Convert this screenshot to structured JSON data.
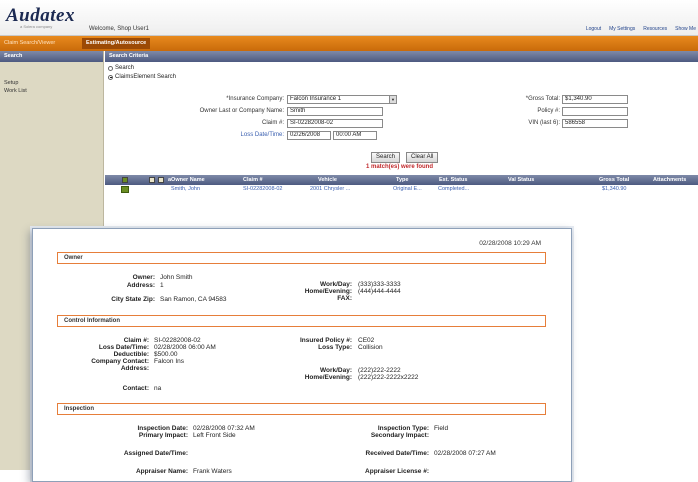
{
  "app": {
    "logo_text": "Audatex",
    "logo_tagline": "a Solera company",
    "welcome": "Welcome, Shop User1",
    "top_links": [
      "Logout",
      "My Settings",
      "Resources",
      "Show Me"
    ],
    "tabs": [
      "Claim Search/Viewer",
      "Estimating/Autosource"
    ],
    "active_tab_index": 1,
    "colors": {
      "brand_orange": "#d9761a",
      "header_blue": "#5b6790",
      "link_blue": "#3a5fb0",
      "alert_red": "#c0282b"
    }
  },
  "sidebar": {
    "header": "Search",
    "items": [
      "Setup",
      "Work List"
    ]
  },
  "criteria": {
    "header": "Search Criteria",
    "radio_search": "Search",
    "radio_claims_element": "ClaimsElement Search",
    "selected_radio": "ClaimsElement Search",
    "insurance_label": "*Insurance Company:",
    "insurance_value": "Falcon Insurance 1",
    "owner_label": "Owner Last or Company Name:",
    "owner_value": "Smith",
    "claim_label": "Claim #:",
    "claim_value": "SI-02282008-02",
    "loss_label": "Loss Date/Time:",
    "loss_date": "02/26/2008",
    "loss_time": "00:00 AM",
    "gross_label": "*Gross Total:",
    "gross_value": "$1,340.90",
    "policy_label": "Policy #:",
    "policy_value": "",
    "vin_label": "VIN (last 6):",
    "vin_value": "586558",
    "search_button": "Search",
    "clear_button": "Clear All",
    "matches_text": "1 match(es) were found"
  },
  "results": {
    "columns": [
      "aOwner Name",
      "Claim #",
      "Vehicle",
      "Type",
      "Est. Status",
      "Val Status",
      "Gross Total",
      "Attachments"
    ],
    "rows": [
      {
        "owner": "Smith, John",
        "claim": "SI-02282008-02",
        "vehicle": "2001 Chrysler ...",
        "type": "Original E...",
        "est_status": "Completed...",
        "val_status": "",
        "gross_total": "$1,340.90",
        "attachments": ""
      }
    ]
  },
  "report": {
    "datetime": "02/28/2008 10:29 AM",
    "owner_section": {
      "title": "Owner",
      "owner_label": "Owner:",
      "owner_value": "John Smith",
      "address_label": "Address:",
      "address_value": "1",
      "csz_label": "City State Zip:",
      "csz_value": "San Ramon, CA 94583",
      "work_label": "Work/Day:",
      "work_value": "(333)333-3333",
      "home_label": "Home/Evening:",
      "home_value": "(444)444-4444",
      "fax_label": "FAX:",
      "fax_value": ""
    },
    "control_section": {
      "title": "Control Information",
      "claim_label": "Claim #:",
      "claim_value": "SI-02282008-02",
      "loss_label": "Loss Date/Time:",
      "loss_value": "02/28/2008 06:00 AM",
      "deductible_label": "Deductible:",
      "deductible_value": "$500.00",
      "company_label": "Company Contact:",
      "company_value": "Falcon Ins",
      "address_label": "Address:",
      "address_value": "",
      "contact_label": "Contact:",
      "contact_value": "na",
      "policy_label": "Insured Policy #:",
      "policy_value": "CE02",
      "losstype_label": "Loss Type:",
      "losstype_value": "Collision",
      "work_label": "Work/Day:",
      "work_value": "(222)222-2222",
      "home_label": "Home/Evening:",
      "home_value": "(222)222-2222x2222"
    },
    "inspection_section": {
      "title": "Inspection",
      "date_label": "Inspection Date:",
      "date_value": "02/28/2008 07:32 AM",
      "impact_label": "Primary Impact:",
      "impact_value": "Left Front Side",
      "type_label": "Inspection Type:",
      "type_value": "Field",
      "secondary_label": "Secondary Impact:",
      "secondary_value": "",
      "assigned_label": "Assigned Date/Time:",
      "assigned_value": "",
      "received_label": "Received Date/Time:",
      "received_value": "02/28/2008 07:27 AM",
      "appraiser_label": "Appraiser Name:",
      "appraiser_value": "Frank Waters",
      "license_label": "Appraiser License #:",
      "license_value": ""
    }
  }
}
